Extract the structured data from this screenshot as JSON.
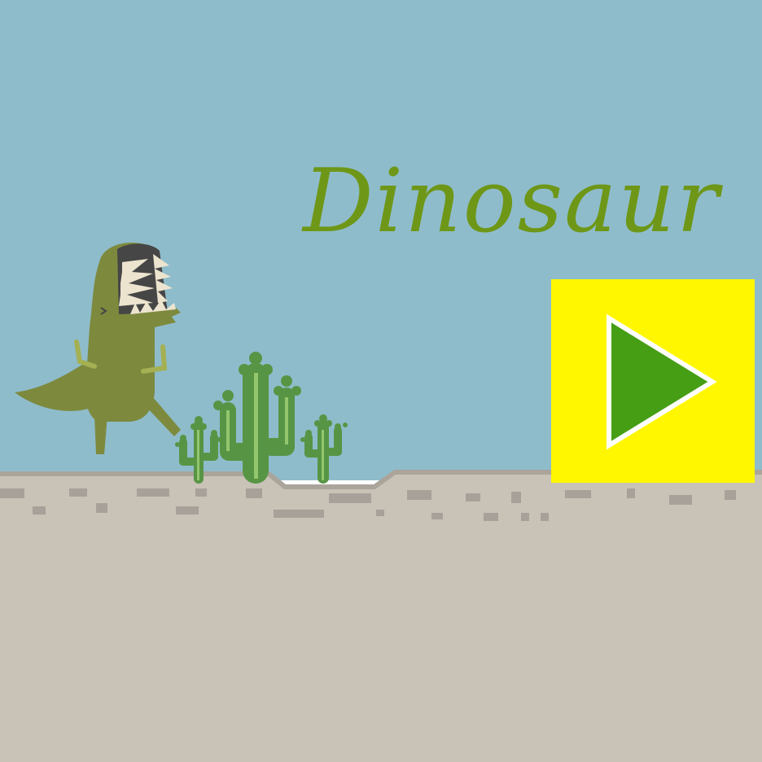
{
  "title": "Dinosaur",
  "play_button": {
    "icon": "play-icon"
  },
  "colors": {
    "sky": "#8fbccb",
    "ground": "#c9c2b6",
    "ground_edge": "#aaa49b",
    "ground_specks": "#a7a19a",
    "title": "#6e9718",
    "play_bg": "#fff700",
    "play_triangle": "#469e15",
    "play_outline": "#ffffff",
    "dino_body": "#7d8a3e",
    "dino_belly": "#a4b052",
    "mouth": "#464646",
    "teeth": "#ede4cf",
    "cactus": "#579545",
    "cactus_stripe": "#93c66d"
  }
}
